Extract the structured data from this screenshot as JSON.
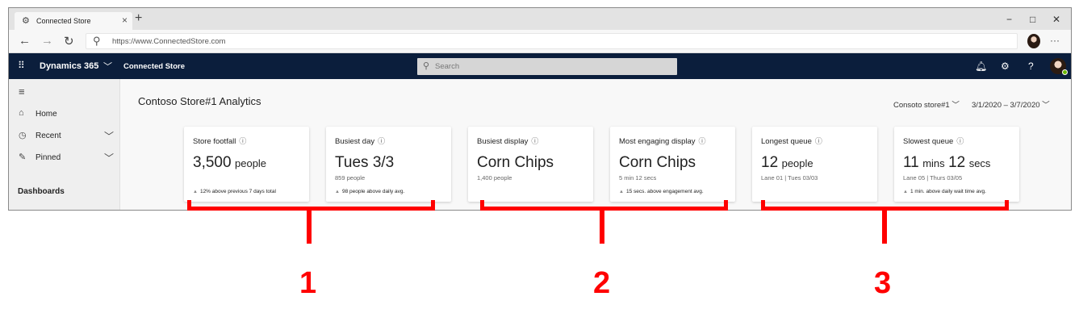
{
  "browser": {
    "tab_title": "Connected Store",
    "tab_close": "×",
    "new_tab": "+",
    "minimize": "−",
    "maximize": "□",
    "close": "✕",
    "back": "←",
    "forward": "→",
    "refresh": "↻",
    "url": "https://www.ConnectedStore.com",
    "more": "···"
  },
  "header": {
    "product": "Dynamics 365",
    "app_name": "Connected Store",
    "search_placeholder": "Search"
  },
  "sidebar": {
    "items": [
      {
        "label": "Home"
      },
      {
        "label": "Recent"
      },
      {
        "label": "Pinned"
      }
    ],
    "section_label": "Dashboards"
  },
  "main": {
    "title": "Contoso Store#1 Analytics",
    "store_selector": "Consoto store#1",
    "date_range": "3/1/2020 – 3/7/2020",
    "cards": [
      {
        "title": "Store footfall",
        "value": "3,500",
        "unit": "people",
        "subtitle": "",
        "footer": "12% above previous 7 days total"
      },
      {
        "title": "Busiest day",
        "value": "Tues 3/3",
        "unit": "",
        "subtitle": "859 people",
        "footer": "98 people above daily avg."
      },
      {
        "title": "Busiest display",
        "value": "Corn Chips",
        "unit": "",
        "subtitle": "1,400 people",
        "footer": ""
      },
      {
        "title": "Most engaging display",
        "value": "Corn Chips",
        "unit": "",
        "subtitle": "5 min 12 secs",
        "footer": "15 secs. above engagement avg."
      },
      {
        "title": "Longest queue",
        "value": "12",
        "unit": "people",
        "subtitle": "Lane 01 | Tues 03/03",
        "footer": ""
      },
      {
        "title": "Slowest queue",
        "value": "11",
        "unit": "mins",
        "value2": "12",
        "unit2": "secs",
        "subtitle": "Lane 05 | Thurs 03/05",
        "footer": "1 min. above daily wait time avg."
      }
    ]
  },
  "annotations": {
    "labels": [
      "1",
      "2",
      "3"
    ],
    "color": "#ff0000"
  },
  "colors": {
    "app_header": "#0b1e3c",
    "presence": "#6bb700"
  }
}
